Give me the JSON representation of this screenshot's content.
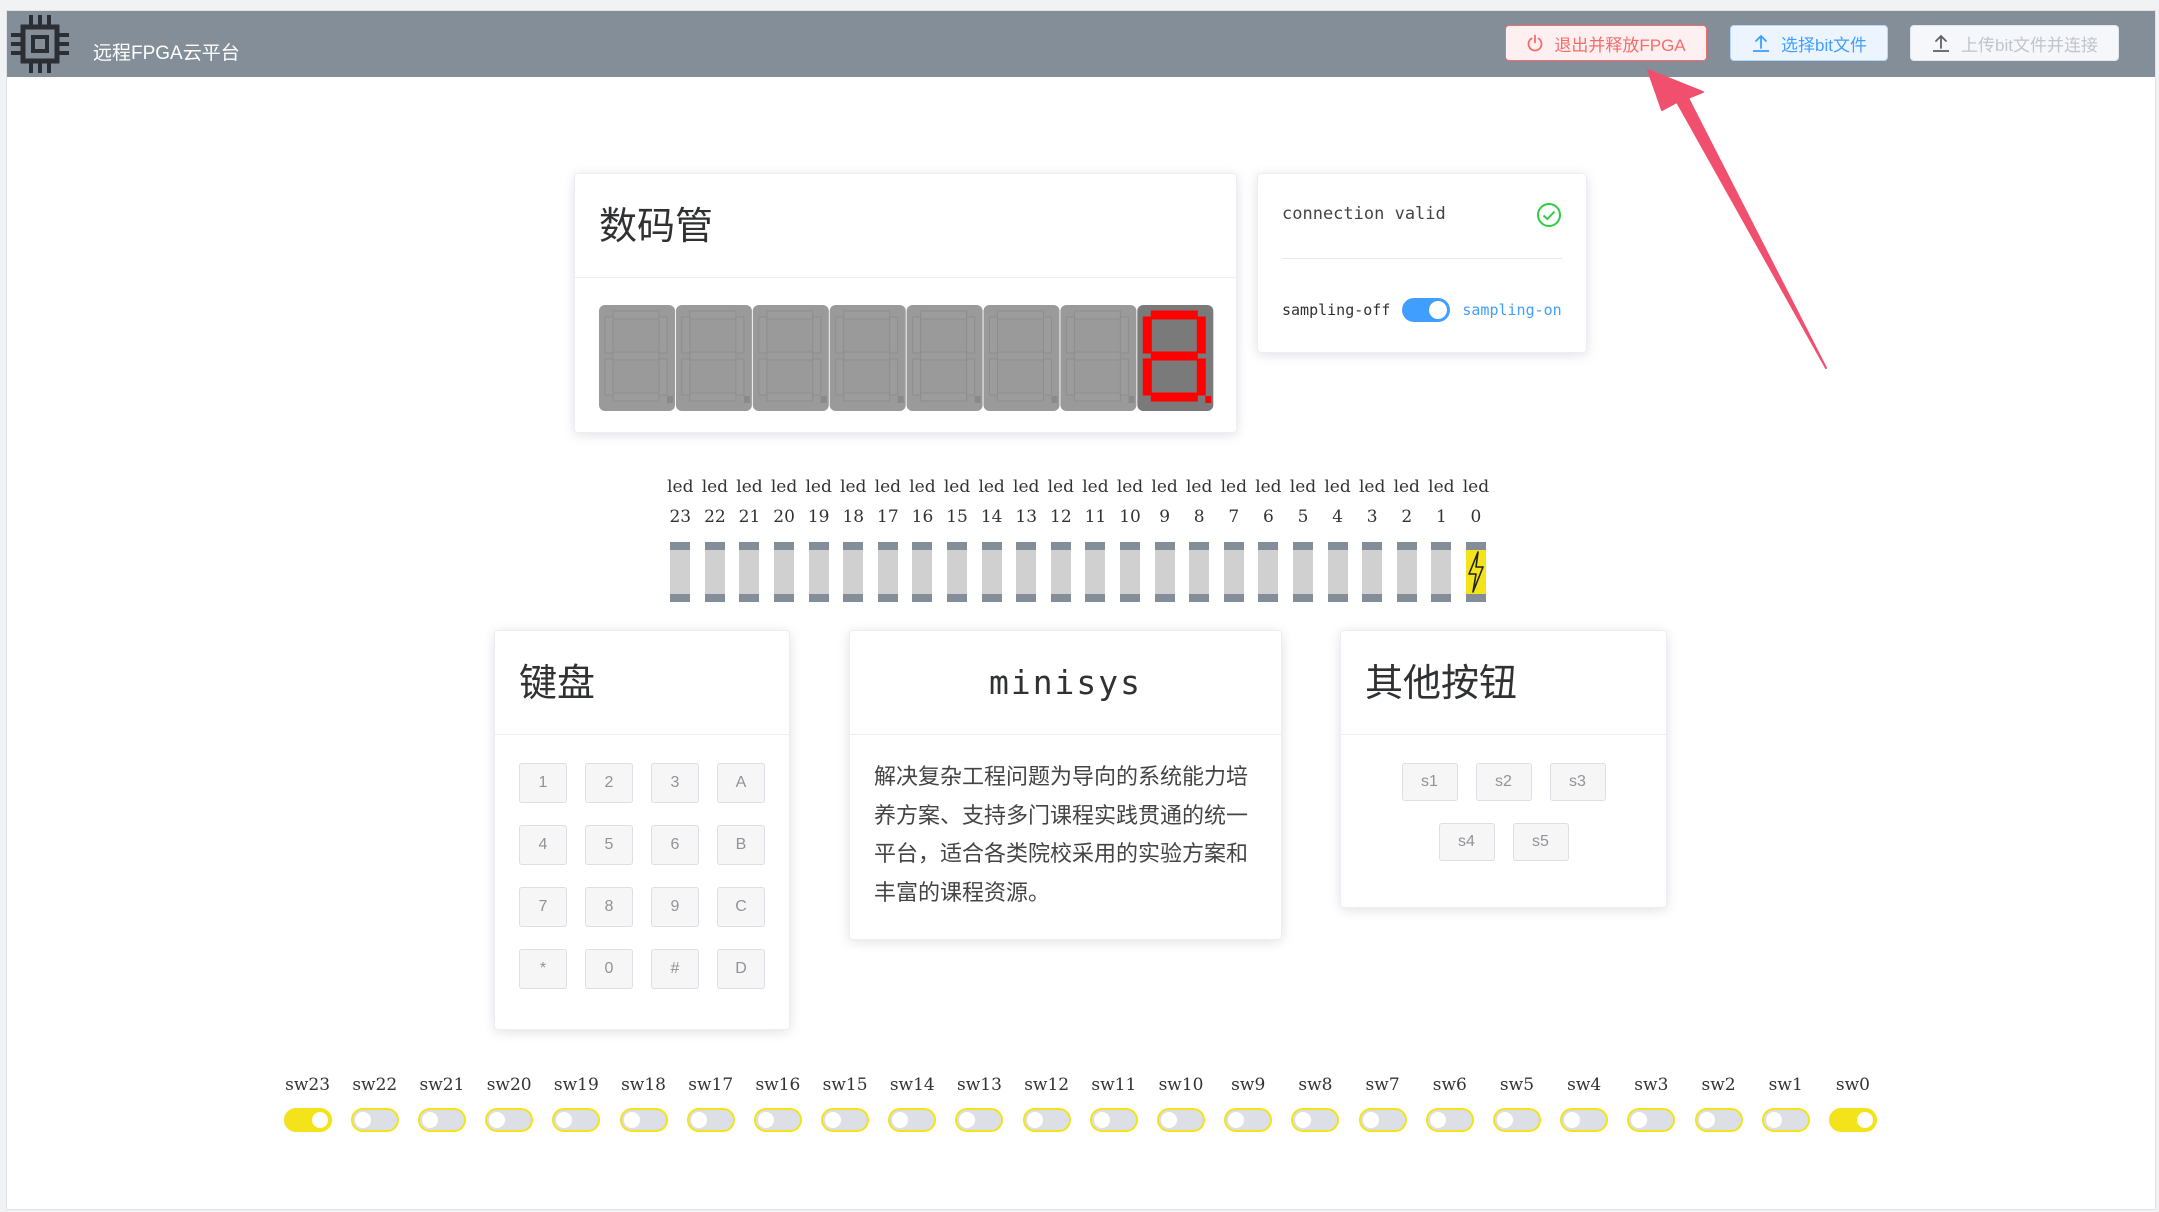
{
  "header": {
    "app_title": "远程FPGA云平台",
    "logo_icon": "chip-icon",
    "buttons": {
      "exit_label": "退出并释放FPGA",
      "choose_label": "选择bit文件",
      "upload_label": "上传bit文件并连接"
    }
  },
  "seven_seg": {
    "title": "数码管",
    "digit_count": 8,
    "active_digit_index": 7,
    "active_color": "#ff0000",
    "inactive_color": "#9a9a9a"
  },
  "connection": {
    "status_text": "connection valid",
    "sampling_off_label": "sampling-off",
    "sampling_on_label": "sampling-on",
    "sampling_enabled": true
  },
  "leds": {
    "items": [
      {
        "prefix": "led",
        "num": "23",
        "lit": false
      },
      {
        "prefix": "led",
        "num": "22",
        "lit": false
      },
      {
        "prefix": "led",
        "num": "21",
        "lit": false
      },
      {
        "prefix": "led",
        "num": "20",
        "lit": false
      },
      {
        "prefix": "led",
        "num": "19",
        "lit": false
      },
      {
        "prefix": "led",
        "num": "18",
        "lit": false
      },
      {
        "prefix": "led",
        "num": "17",
        "lit": false
      },
      {
        "prefix": "led",
        "num": "16",
        "lit": false
      },
      {
        "prefix": "led",
        "num": "15",
        "lit": false
      },
      {
        "prefix": "led",
        "num": "14",
        "lit": false
      },
      {
        "prefix": "led",
        "num": "13",
        "lit": false
      },
      {
        "prefix": "led",
        "num": "12",
        "lit": false
      },
      {
        "prefix": "led",
        "num": "11",
        "lit": false
      },
      {
        "prefix": "led",
        "num": "10",
        "lit": false
      },
      {
        "prefix": "led",
        "num": "9",
        "lit": false
      },
      {
        "prefix": "led",
        "num": "8",
        "lit": false
      },
      {
        "prefix": "led",
        "num": "7",
        "lit": false
      },
      {
        "prefix": "led",
        "num": "6",
        "lit": false
      },
      {
        "prefix": "led",
        "num": "5",
        "lit": false
      },
      {
        "prefix": "led",
        "num": "4",
        "lit": false
      },
      {
        "prefix": "led",
        "num": "3",
        "lit": false
      },
      {
        "prefix": "led",
        "num": "2",
        "lit": false
      },
      {
        "prefix": "led",
        "num": "1",
        "lit": false
      },
      {
        "prefix": "led",
        "num": "0",
        "lit": true
      }
    ]
  },
  "keyboard": {
    "title": "键盘",
    "keys": [
      "1",
      "2",
      "3",
      "A",
      "4",
      "5",
      "6",
      "B",
      "7",
      "8",
      "9",
      "C",
      "*",
      "0",
      "#",
      "D"
    ]
  },
  "minisys": {
    "title": "minisys",
    "description": "解决复杂工程问题为导向的系统能力培养方案、支持多门课程实践贯通的统一平台，适合各类院校采用的实验方案和丰富的课程资源。"
  },
  "other_buttons": {
    "title": "其他按钮",
    "buttons": [
      "s1",
      "s2",
      "s3",
      "s4",
      "s5"
    ]
  },
  "switches": {
    "items": [
      {
        "label": "sw23",
        "on": true
      },
      {
        "label": "sw22",
        "on": false
      },
      {
        "label": "sw21",
        "on": false
      },
      {
        "label": "sw20",
        "on": false
      },
      {
        "label": "sw19",
        "on": false
      },
      {
        "label": "sw18",
        "on": false
      },
      {
        "label": "sw17",
        "on": false
      },
      {
        "label": "sw16",
        "on": false
      },
      {
        "label": "sw15",
        "on": false
      },
      {
        "label": "sw14",
        "on": false
      },
      {
        "label": "sw13",
        "on": false
      },
      {
        "label": "sw12",
        "on": false
      },
      {
        "label": "sw11",
        "on": false
      },
      {
        "label": "sw10",
        "on": false
      },
      {
        "label": "sw9",
        "on": false
      },
      {
        "label": "sw8",
        "on": false
      },
      {
        "label": "sw7",
        "on": false
      },
      {
        "label": "sw6",
        "on": false
      },
      {
        "label": "sw5",
        "on": false
      },
      {
        "label": "sw4",
        "on": false
      },
      {
        "label": "sw3",
        "on": false
      },
      {
        "label": "sw2",
        "on": false
      },
      {
        "label": "sw1",
        "on": false
      },
      {
        "label": "sw0",
        "on": true
      }
    ]
  },
  "colors": {
    "header_bg": "#848e99",
    "accent_blue": "#409eff",
    "danger_red": "#f56c6c",
    "switch_yellow": "#f4e21a",
    "annotation_arrow": "#f0506e"
  }
}
